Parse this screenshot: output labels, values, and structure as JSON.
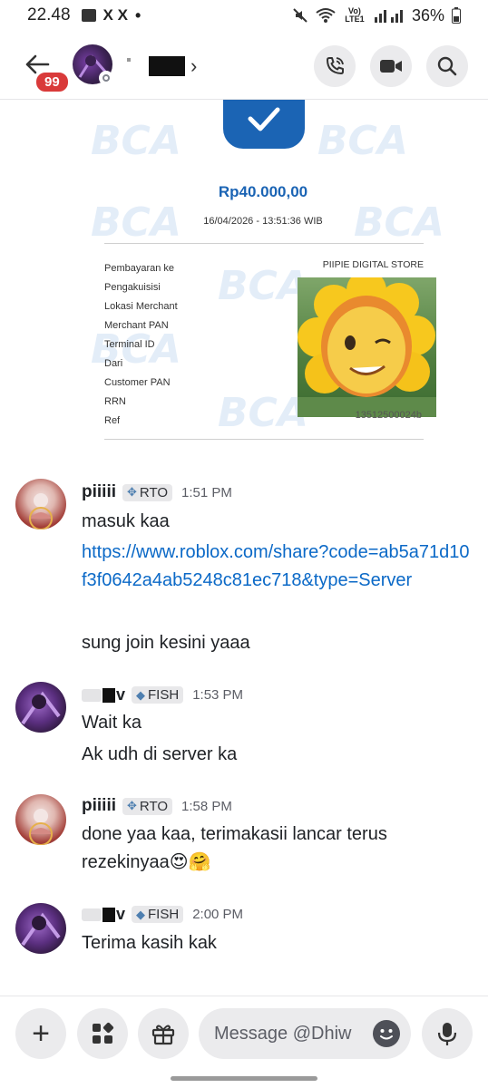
{
  "status_bar": {
    "time": "22.48",
    "app_letters": "X X",
    "dot": "•",
    "lte_label": "Vo) LTE1",
    "battery": "36%"
  },
  "header": {
    "unread_badge": "99",
    "chevron": "›"
  },
  "receipt": {
    "watermark": "BCA",
    "amount": "Rp40.000,00",
    "datetime": "16/04/2026 - 13:51:36 WIB",
    "labels": [
      "Pembayaran ke",
      "Pengakuisisi",
      "Lokasi Merchant",
      "Merchant PAN",
      "Terminal ID",
      "Dari",
      "Customer PAN",
      "RRN",
      "Ref"
    ],
    "store": "PIIPIE DIGITAL STORE",
    "ref_tail": "13512500024b"
  },
  "messages": [
    {
      "username": "piiiii",
      "tag": "RTO",
      "time": "1:51 PM",
      "lines": [
        "masuk kaa"
      ],
      "link": "https://www.roblox.com/share?code=ab5a71d10f3f0642a4ab5248c81ec718&type=Server",
      "after_link": "sung join kesini yaaa"
    },
    {
      "username_suffix": "v",
      "tag": "FISH",
      "time": "1:53 PM",
      "lines": [
        "Wait ka",
        "Ak udh di server ka"
      ]
    },
    {
      "username": "piiiii",
      "tag": "RTO",
      "time": "1:58 PM",
      "text": "done yaa kaa, terimakasii lancar terus rezekinyaa😍🤗"
    },
    {
      "username_suffix": "v",
      "tag": "FISH",
      "time": "2:00 PM",
      "lines": [
        "Terima kasih kak"
      ]
    }
  ],
  "composer": {
    "placeholder": "Message @Dhiw",
    "plus": "+"
  },
  "colors": {
    "accent_blue": "#1b64b4",
    "link": "#0b69c7",
    "badge_red": "#d93a3a"
  },
  "icons": [
    "back-arrow-icon",
    "phone-icon",
    "video-icon",
    "search-icon",
    "plus-icon",
    "apps-icon",
    "gift-icon",
    "emoji-icon",
    "microphone-icon"
  ]
}
